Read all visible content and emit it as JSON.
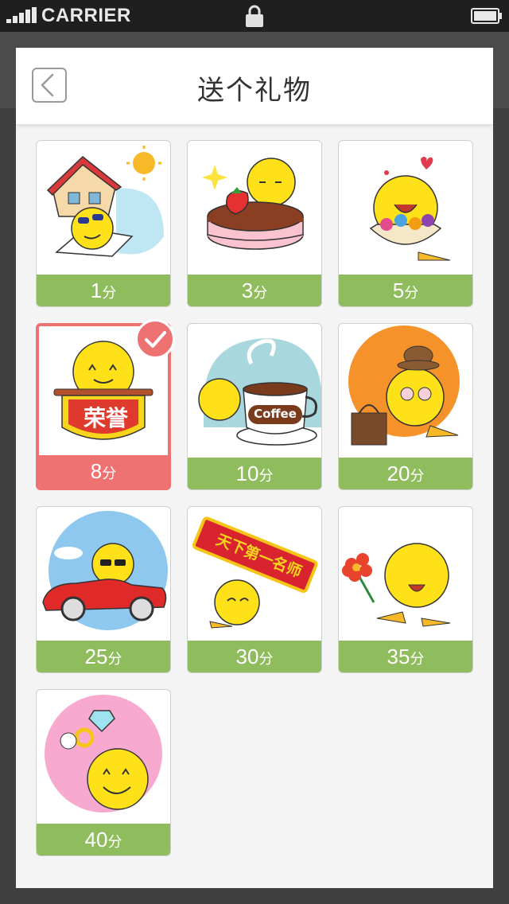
{
  "status_bar": {
    "carrier": "CARRIER",
    "signal_icon": "signal-bars-icon",
    "lock_icon": "lock-icon",
    "battery_icon": "battery-icon"
  },
  "header": {
    "title": "送个礼物",
    "back_icon": "chevron-left-icon"
  },
  "colors": {
    "price_bar": "#8fbc5c",
    "selected": "#ee7272"
  },
  "unit": "分",
  "gifts": [
    {
      "name": "beach-vacation",
      "price": "1",
      "selected": false
    },
    {
      "name": "strawberry-cake",
      "price": "3",
      "selected": false
    },
    {
      "name": "flower-basket",
      "price": "5",
      "selected": false
    },
    {
      "name": "honor-banner",
      "price": "8",
      "selected": true,
      "banner_text": "荣誉"
    },
    {
      "name": "coffee-cup",
      "price": "10",
      "selected": false,
      "cup_text": "Coffee"
    },
    {
      "name": "designer-bag",
      "price": "20",
      "selected": false
    },
    {
      "name": "red-convertible",
      "price": "25",
      "selected": false
    },
    {
      "name": "number-one-sign",
      "price": "30",
      "selected": false,
      "sign_text": "天下第一名师"
    },
    {
      "name": "flower-gift",
      "price": "35",
      "selected": false
    },
    {
      "name": "diamond-ring",
      "price": "40",
      "selected": false
    }
  ]
}
